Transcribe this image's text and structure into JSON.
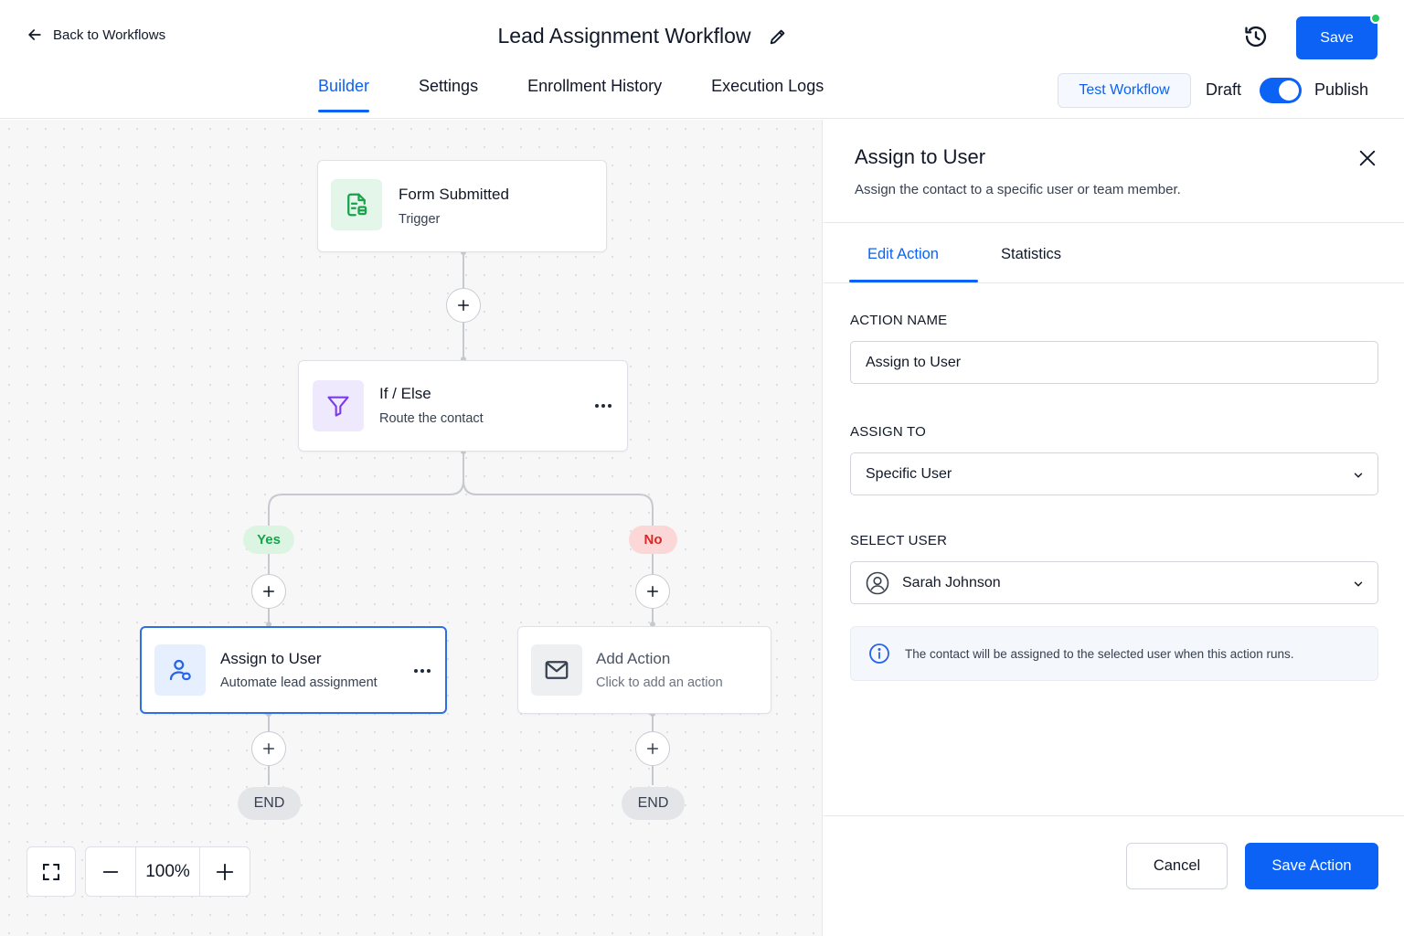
{
  "header": {
    "back_label": "Back to Workflows",
    "title": "Lead Assignment Workflow",
    "save_label": "Save",
    "tabs": [
      {
        "label": "Builder",
        "active": true
      },
      {
        "label": "Settings",
        "active": false
      },
      {
        "label": "Enrollment History",
        "active": false
      },
      {
        "label": "Execution Logs",
        "active": false
      }
    ],
    "test_workflow_label": "Test Workflow",
    "draft_label": "Draft",
    "publish_label": "Publish",
    "publish_toggle_on": true,
    "accent_color": "#0b62f5",
    "status_dot_color": "#22c55e"
  },
  "canvas": {
    "nodes": {
      "trigger": {
        "title": "Form Submitted",
        "subtitle": "Trigger",
        "icon": "form-document-icon"
      },
      "condition": {
        "title": "If / Else",
        "subtitle": "Route the contact",
        "icon": "filter-icon"
      },
      "assign": {
        "title": "Assign to User",
        "subtitle": "Automate lead assignment",
        "icon": "user-icon"
      },
      "add_action": {
        "title": "Add Action",
        "subtitle": "Click to add an action",
        "icon": "mail-icon"
      }
    },
    "branches": {
      "yes": "Yes",
      "no": "No"
    },
    "end_label": "END",
    "zoom": "100%"
  },
  "panel": {
    "title": "Assign to User",
    "description": "Assign the contact to a specific user or team member.",
    "tabs": [
      {
        "label": "Edit Action",
        "active": true
      },
      {
        "label": "Statistics",
        "active": false
      }
    ],
    "action_name_label": "ACTION NAME",
    "action_name_value": "Assign to User",
    "assign_to_label": "ASSIGN TO",
    "assign_to_value": "Specific User",
    "select_user_label": "SELECT USER",
    "select_user_value": "Sarah Johnson",
    "info_text": "The contact will be assigned to the selected user when this action runs.",
    "cancel_label": "Cancel",
    "save_action_label": "Save Action"
  }
}
